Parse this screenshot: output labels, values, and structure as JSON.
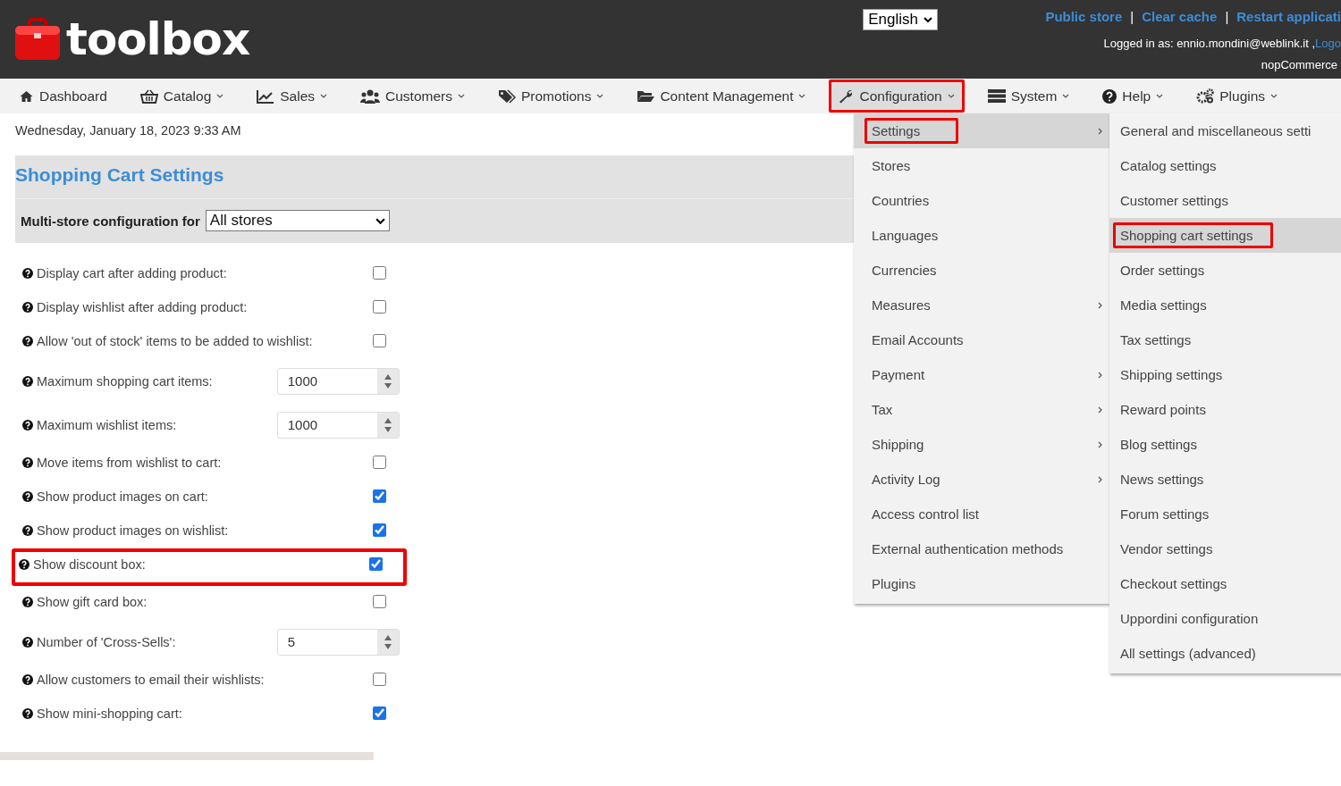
{
  "header": {
    "logo_text": "toolbox",
    "language": {
      "value": "English"
    },
    "links": [
      "Public store",
      "Clear cache",
      "Restart applicati"
    ],
    "link_separator": "|",
    "logged_in_label": "Logged in as: ennio.mondini@weblink.it ,",
    "logout_link": "Logo",
    "store_name": "nopCommerce"
  },
  "nav": [
    {
      "label": "Dashboard",
      "caret": false,
      "selected": false,
      "highlighted": false
    },
    {
      "label": "Catalog",
      "caret": true,
      "selected": false,
      "highlighted": false
    },
    {
      "label": "Sales",
      "caret": true,
      "selected": false,
      "highlighted": false
    },
    {
      "label": "Customers",
      "caret": true,
      "selected": false,
      "highlighted": false
    },
    {
      "label": "Promotions",
      "caret": true,
      "selected": false,
      "highlighted": false
    },
    {
      "label": "Content Management",
      "caret": true,
      "selected": false,
      "highlighted": false
    },
    {
      "label": "Configuration",
      "caret": true,
      "selected": true,
      "highlighted": true
    },
    {
      "label": "System",
      "caret": true,
      "selected": false,
      "highlighted": false
    },
    {
      "label": "Help",
      "caret": true,
      "selected": false,
      "highlighted": false
    },
    {
      "label": "Plugins",
      "caret": true,
      "selected": false,
      "highlighted": false
    }
  ],
  "date": "Wednesday, January 18, 2023 9:33 AM",
  "title": "Shopping Cart Settings",
  "store_config": {
    "label": "Multi-store configuration for",
    "value": "All stores"
  },
  "settings": [
    {
      "kind": "checkbox",
      "label": "Display cart after adding product:",
      "checked": false,
      "highlighted": false
    },
    {
      "kind": "checkbox",
      "label": "Display wishlist after adding product:",
      "checked": false,
      "highlighted": false
    },
    {
      "kind": "checkbox",
      "label": "Allow 'out of stock' items to be added to wishlist:",
      "checked": false,
      "highlighted": false
    },
    {
      "kind": "number",
      "label": "Maximum shopping cart items:",
      "value": "1000",
      "highlighted": false
    },
    {
      "kind": "number",
      "label": "Maximum wishlist items:",
      "value": "1000",
      "highlighted": false
    },
    {
      "kind": "checkbox",
      "label": "Move items from wishlist to cart:",
      "checked": false,
      "highlighted": false
    },
    {
      "kind": "checkbox",
      "label": "Show product images on cart:",
      "checked": true,
      "highlighted": false
    },
    {
      "kind": "checkbox",
      "label": "Show product images on wishlist:",
      "checked": true,
      "highlighted": false
    },
    {
      "kind": "checkbox",
      "label": "Show discount box:",
      "checked": true,
      "highlighted": true
    },
    {
      "kind": "checkbox",
      "label": "Show gift card box:",
      "checked": false,
      "highlighted": false
    },
    {
      "kind": "number",
      "label": "Number of 'Cross-Sells':",
      "value": "5",
      "highlighted": false
    },
    {
      "kind": "checkbox",
      "label": "Allow customers to email their wishlists:",
      "checked": false,
      "highlighted": false
    },
    {
      "kind": "checkbox",
      "label": "Show mini-shopping cart:",
      "checked": true,
      "highlighted": false
    }
  ],
  "config_menu": [
    {
      "label": "Settings",
      "submenu": true,
      "selected": true,
      "highlighted": true
    },
    {
      "label": "Stores",
      "submenu": false,
      "selected": false,
      "highlighted": false
    },
    {
      "label": "Countries",
      "submenu": false,
      "selected": false,
      "highlighted": false
    },
    {
      "label": "Languages",
      "submenu": false,
      "selected": false,
      "highlighted": false
    },
    {
      "label": "Currencies",
      "submenu": false,
      "selected": false,
      "highlighted": false
    },
    {
      "label": "Measures",
      "submenu": true,
      "selected": false,
      "highlighted": false
    },
    {
      "label": "Email Accounts",
      "submenu": false,
      "selected": false,
      "highlighted": false
    },
    {
      "label": "Payment",
      "submenu": true,
      "selected": false,
      "highlighted": false
    },
    {
      "label": "Tax",
      "submenu": true,
      "selected": false,
      "highlighted": false
    },
    {
      "label": "Shipping",
      "submenu": true,
      "selected": false,
      "highlighted": false
    },
    {
      "label": "Activity Log",
      "submenu": true,
      "selected": false,
      "highlighted": false
    },
    {
      "label": "Access control list",
      "submenu": false,
      "selected": false,
      "highlighted": false
    },
    {
      "label": "External authentication methods",
      "submenu": false,
      "selected": false,
      "highlighted": false
    },
    {
      "label": "Plugins",
      "submenu": false,
      "selected": false,
      "highlighted": false
    }
  ],
  "settings_menu": [
    {
      "label": "General and miscellaneous setti",
      "selected": false,
      "highlighted": false
    },
    {
      "label": "Catalog settings",
      "selected": false,
      "highlighted": false
    },
    {
      "label": "Customer settings",
      "selected": false,
      "highlighted": false
    },
    {
      "label": "Shopping cart settings",
      "selected": true,
      "highlighted": true
    },
    {
      "label": "Order settings",
      "selected": false,
      "highlighted": false
    },
    {
      "label": "Media settings",
      "selected": false,
      "highlighted": false
    },
    {
      "label": "Tax settings",
      "selected": false,
      "highlighted": false
    },
    {
      "label": "Shipping settings",
      "selected": false,
      "highlighted": false
    },
    {
      "label": "Reward points",
      "selected": false,
      "highlighted": false
    },
    {
      "label": "Blog settings",
      "selected": false,
      "highlighted": false
    },
    {
      "label": "News settings",
      "selected": false,
      "highlighted": false
    },
    {
      "label": "Forum settings",
      "selected": false,
      "highlighted": false
    },
    {
      "label": "Vendor settings",
      "selected": false,
      "highlighted": false
    },
    {
      "label": "Checkout settings",
      "selected": false,
      "highlighted": false
    },
    {
      "label": "Uppordini configuration",
      "selected": false,
      "highlighted": false
    },
    {
      "label": "All settings (advanced)",
      "selected": false,
      "highlighted": false
    }
  ]
}
